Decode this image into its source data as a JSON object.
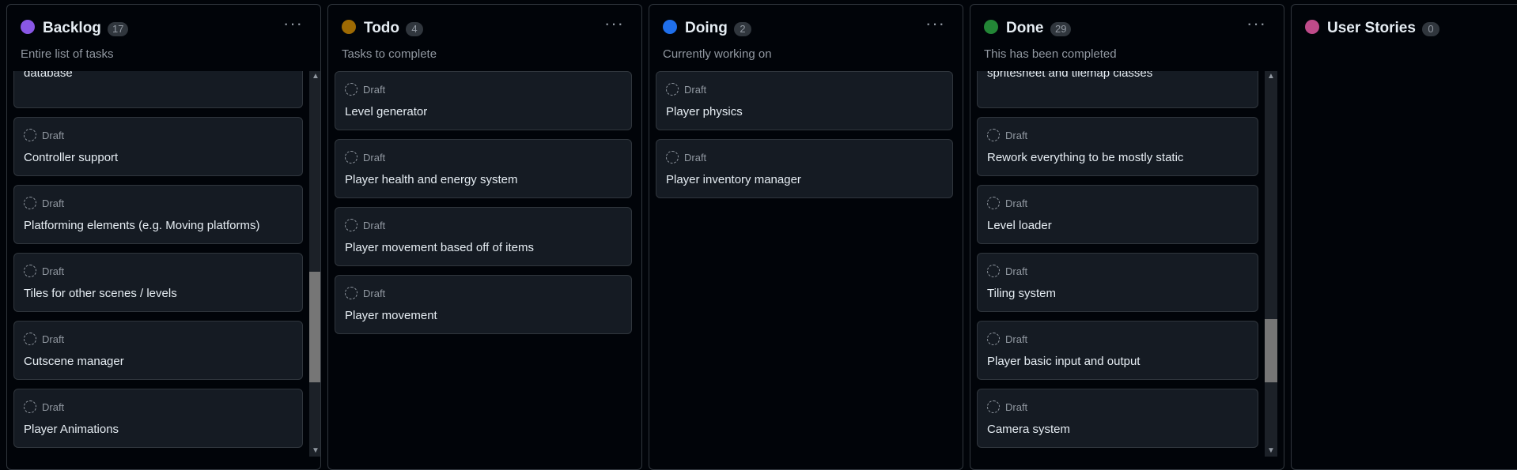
{
  "columns": [
    {
      "name": "Backlog",
      "count": "17",
      "subtitle": "Entire list of tasks",
      "color": "#8957e5",
      "cards": [
        {
          "draft": "",
          "title": "Fetching and sending player scores and times to database"
        },
        {
          "draft": "Draft",
          "title": "Controller support"
        },
        {
          "draft": "Draft",
          "title": "Platforming elements (e.g. Moving platforms)"
        },
        {
          "draft": "Draft",
          "title": "Tiles for other scenes / levels"
        },
        {
          "draft": "Draft",
          "title": "Cutscene manager"
        },
        {
          "draft": "Draft",
          "title": "Player Animations"
        }
      ]
    },
    {
      "name": "Todo",
      "count": "4",
      "subtitle": "Tasks to complete",
      "color": "#9e6a03",
      "cards": [
        {
          "draft": "Draft",
          "title": "Level generator"
        },
        {
          "draft": "Draft",
          "title": "Player health and energy system"
        },
        {
          "draft": "Draft",
          "title": "Player movement based off of items"
        },
        {
          "draft": "Draft",
          "title": "Player movement"
        }
      ]
    },
    {
      "name": "Doing",
      "count": "2",
      "subtitle": "Currently working on",
      "color": "#1f6feb",
      "cards": [
        {
          "draft": "Draft",
          "title": "Player physics"
        },
        {
          "draft": "Draft",
          "title": "Player inventory manager"
        }
      ]
    },
    {
      "name": "Done",
      "count": "29",
      "subtitle": "This has been completed",
      "color": "#238636",
      "cards": [
        {
          "draft": "",
          "title": "Combine tmx and tsx map and tilesets into main spritesheet and tilemap classes"
        },
        {
          "draft": "Draft",
          "title": "Rework everything to be mostly static"
        },
        {
          "draft": "Draft",
          "title": "Level loader"
        },
        {
          "draft": "Draft",
          "title": "Tiling system"
        },
        {
          "draft": "Draft",
          "title": "Player basic input and output"
        },
        {
          "draft": "Draft",
          "title": "Camera system"
        }
      ]
    },
    {
      "name": "User Stories",
      "count": "0",
      "subtitle": "",
      "color": "#bf4b8a",
      "cards": []
    }
  ],
  "menu_glyph": "···",
  "scroll_up_glyph": "▲",
  "scroll_down_glyph": "▼",
  "icons": {
    "draft": "draft-circle-icon",
    "menu": "more-horizontal-icon"
  }
}
